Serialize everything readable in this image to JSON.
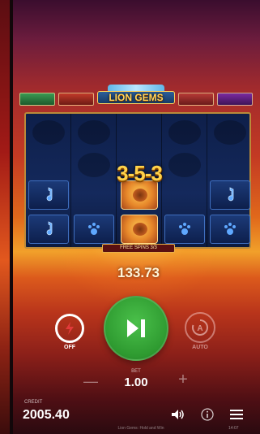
{
  "jackpots": [
    {
      "name": "",
      "amount": ""
    },
    {
      "name": "",
      "amount": ""
    },
    {
      "name": "",
      "amount": ""
    },
    {
      "name": "",
      "amount": ""
    }
  ],
  "logo": {
    "text": "LION GEMS"
  },
  "bonus": {
    "count_text": "3-5-3"
  },
  "free_spins": {
    "text": "FREE SPINS 3/3"
  },
  "win": {
    "amount": "133.73"
  },
  "controls": {
    "turbo_label": "OFF",
    "auto_label": "AUTO",
    "bet_label": "BET",
    "bet_value": "1.00",
    "minus_label": "—",
    "plus_label": "+"
  },
  "footer": {
    "credit_label": "CREDIT",
    "credit_value": "2005.40",
    "game_name": "Lion Gems: Hold and Win",
    "time": "14:07"
  },
  "icons": {
    "turbo": "lightning-icon",
    "spin": "play-skip-icon",
    "auto": "autoplay-icon",
    "sound": "speaker-icon",
    "info": "info-icon",
    "menu": "hamburger-menu-icon"
  },
  "colors": {
    "spin_button": "#2e9a30",
    "bonus_text": "#ffd24a",
    "reel_bg": "#14295c"
  }
}
